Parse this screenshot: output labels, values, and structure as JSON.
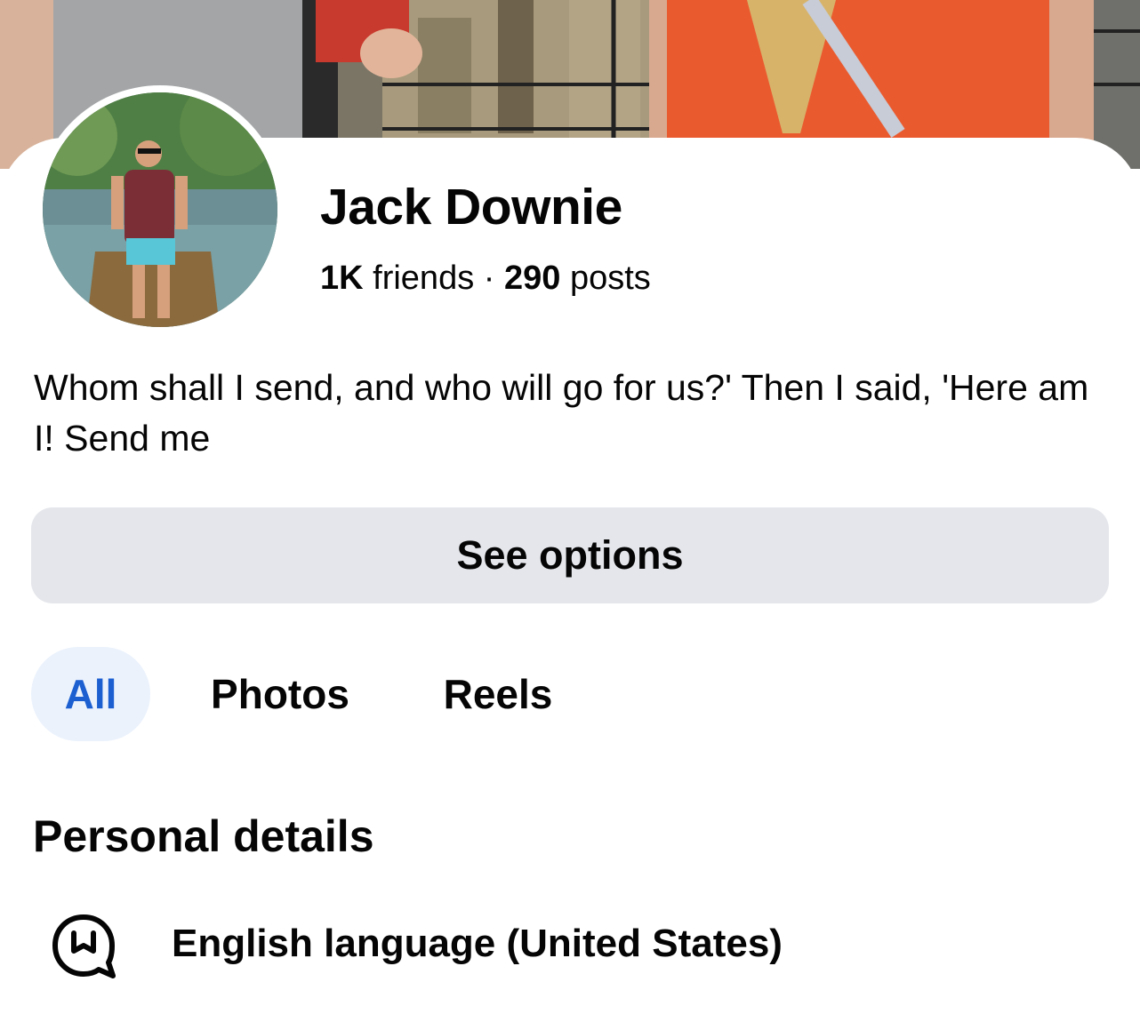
{
  "profile": {
    "name": "Jack Downie",
    "friends_count": "1K",
    "friends_label": "friends",
    "separator": "·",
    "posts_count": "290",
    "posts_label": "posts",
    "bio": "Whom shall I send, and who will go for us?' Then I said, 'Here am I! Send me"
  },
  "actions": {
    "see_options_label": "See options"
  },
  "tabs": [
    {
      "label": "All",
      "active": true
    },
    {
      "label": "Photos",
      "active": false
    },
    {
      "label": "Reels",
      "active": false
    }
  ],
  "personal_details": {
    "title": "Personal details",
    "items": [
      {
        "icon": "speech-bubble-icon",
        "text": "English language (United States)"
      }
    ]
  },
  "colors": {
    "active_tab_text": "#1b5fd1",
    "active_tab_bg": "#ebf2fc",
    "button_bg": "#e4e6eb"
  }
}
